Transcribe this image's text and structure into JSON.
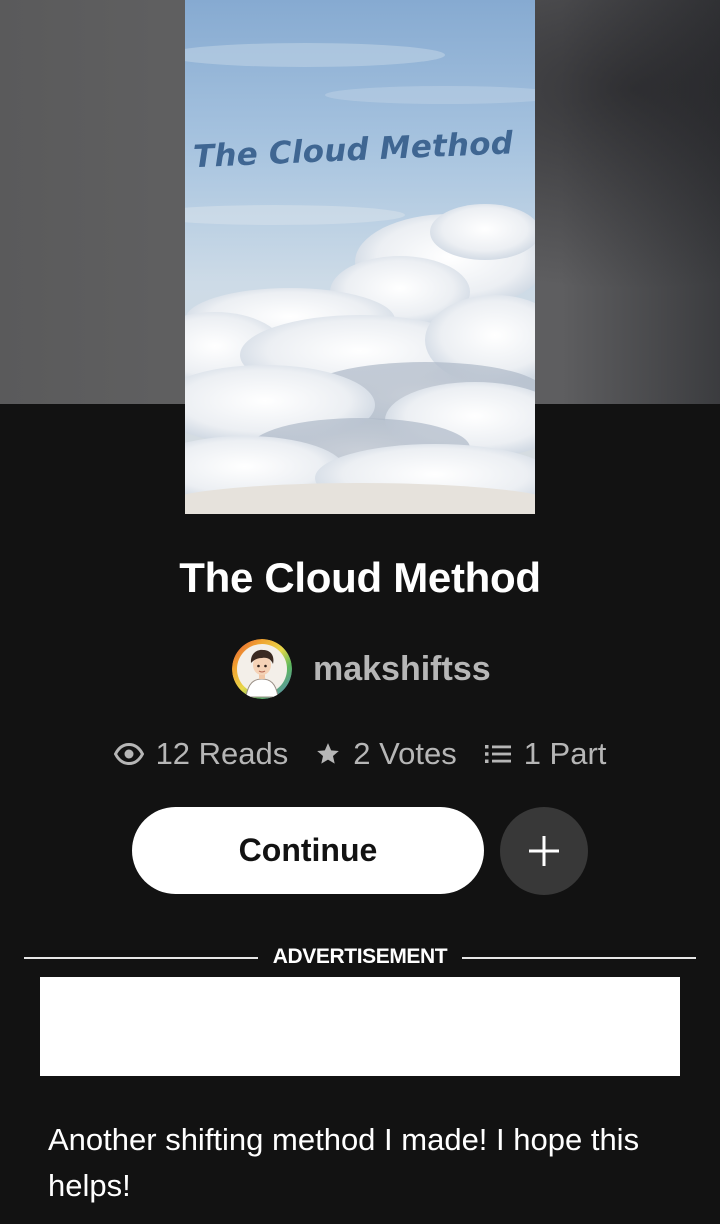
{
  "story": {
    "cover_title": "The Cloud Method",
    "title": "The Cloud Method",
    "author": "makshiftss",
    "description": "Another shifting method I made! I hope this helps!"
  },
  "stats": {
    "reads": "12 Reads",
    "votes": "2 Votes",
    "parts": "1 Part"
  },
  "actions": {
    "continue_label": "Continue",
    "add_icon": "plus-icon"
  },
  "ad": {
    "label": "ADVERTISEMENT"
  },
  "icons": {
    "reads": "eye-icon",
    "votes": "star-icon",
    "parts": "list-icon"
  },
  "colors": {
    "background": "#121212",
    "text_primary": "#ffffff",
    "text_secondary": "#b6b6b6",
    "button_primary_bg": "#ffffff",
    "button_secondary_bg": "#383838"
  }
}
